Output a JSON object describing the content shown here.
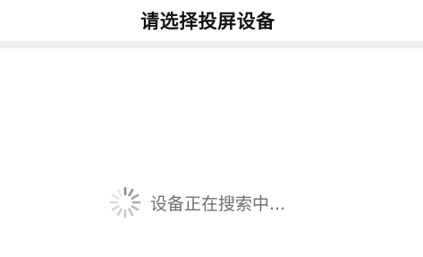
{
  "header": {
    "title": "请选择投屏设备"
  },
  "status": {
    "loading_text": "设备正在搜索中...",
    "spinner_icon": "loading-spinner-icon"
  },
  "colors": {
    "title": "#111111",
    "divider": "#efefef",
    "loading_text": "#6f6f6f",
    "spinner": "#8a8a8a"
  }
}
